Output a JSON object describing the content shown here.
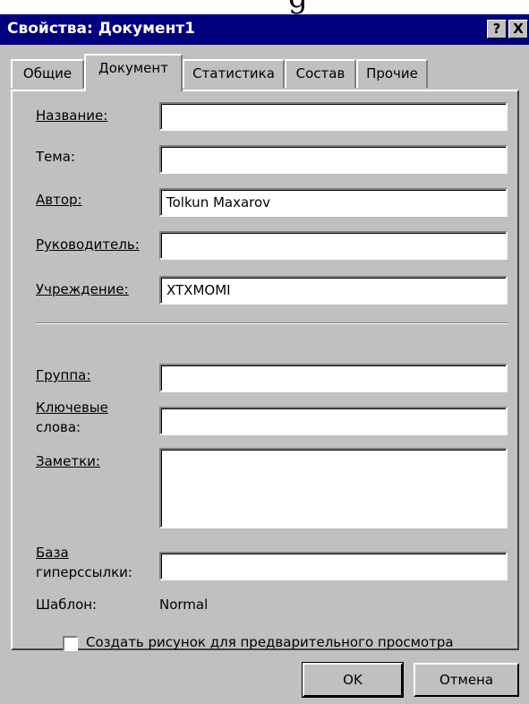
{
  "window": {
    "title": "Свойства: Документ1",
    "help_button": "?",
    "close_button": "X"
  },
  "tabs": [
    {
      "label": "Общие"
    },
    {
      "label": "Документ"
    },
    {
      "label": "Статистика"
    },
    {
      "label": "Состав"
    },
    {
      "label": "Прочие"
    }
  ],
  "fields": {
    "title_label": "Название:",
    "title_value": "",
    "subject_label": "Тема:",
    "subject_value": "",
    "author_label": "Автор:",
    "author_value": "Tolkun Maxarov",
    "manager_label": "Руководитель:",
    "manager_value": "",
    "company_label": "Учреждение:",
    "company_value": "XTXMOMI",
    "category_label": "Группа:",
    "category_value": "",
    "keywords_label_1": "Ключевые",
    "keywords_label_2": "слова:",
    "keywords_value": "",
    "comments_label": "Заметки:",
    "comments_value": "",
    "hyperlink_label_1": "База",
    "hyperlink_label_2": "гиперссылки:",
    "hyperlink_value": "",
    "template_label": "Шаблон:",
    "template_value": "Normal"
  },
  "preview_checkbox": {
    "label": "Создать рисунок для предварительного просмотра",
    "checked": false
  },
  "buttons": {
    "ok": "OK",
    "cancel": "Отмена"
  },
  "colors": {
    "titlebar": "#000080",
    "face": "#c0c0c0"
  }
}
